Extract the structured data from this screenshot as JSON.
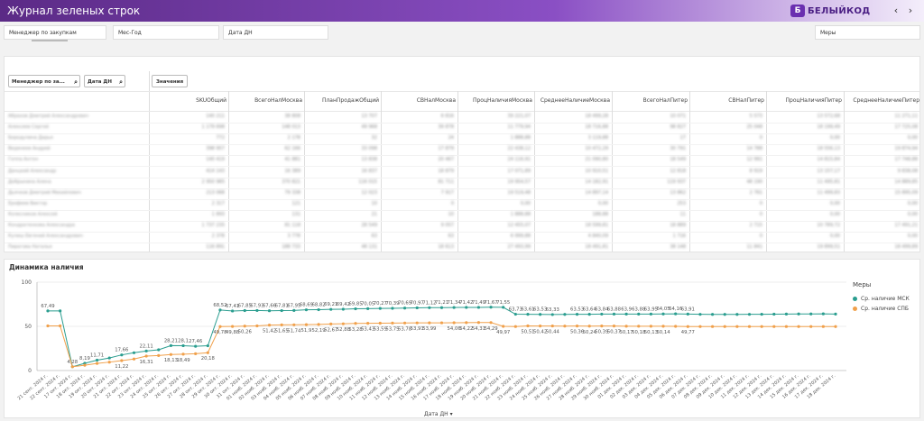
{
  "header": {
    "title": "Журнал зеленых строк",
    "logo_text": "БЕЛЫЙКОД",
    "prev_icon": "chevron-left-icon",
    "next_icon": "chevron-right-icon"
  },
  "filters": {
    "manager": "Менеджер по закупкам",
    "month_year": "Мес-Год",
    "date": "Дата ДН",
    "measures": "Меры"
  },
  "table": {
    "search_manager": "Менеджер по за...",
    "search_date": "Дата ДН",
    "values_button": "Значения",
    "columns": [
      "SKUОбщий",
      "ВсегоНалМосква",
      "ПланПродажОбщий",
      "СВНалМосква",
      "ПроцНаличияМосква",
      "СреднееНаличиеМосква",
      "ВсегоНалПитер",
      "СВНалПитер",
      "ПроцНаличияПитер",
      "СреднееНаличиеПитер"
    ],
    "rows": [
      {
        "label": "Абрахов Дмитрий Александрович",
        "cells": [
          "140 211",
          "38 808",
          "13 707",
          "6 816",
          "39 221,07",
          "18 499,28",
          "10 071",
          "5 573",
          "13 572,68",
          "11 271,11"
        ]
      },
      {
        "label": "Алексеев Сергей",
        "cells": [
          "1 179 698",
          "148 013",
          "49 968",
          "39 878",
          "11 779,94",
          "18 716,88",
          "98 827",
          "25 048",
          "18 199,49",
          "17 725,08"
        ]
      },
      {
        "label": "Бородулина Дарья",
        "cells": [
          "772",
          "2 178",
          "32",
          "24",
          "1 888,88",
          "3 119,88",
          "17",
          "0",
          "0,00",
          "0,00"
        ]
      },
      {
        "label": "Веденеев Андрей",
        "cells": [
          "398 957",
          "62 166",
          "33 098",
          "17 879",
          "22 438,12",
          "10 472,29",
          "30 791",
          "14 788",
          "18 556,13",
          "19 874,94"
        ]
      },
      {
        "label": "Гоппа Антон",
        "cells": [
          "140 419",
          "41 881",
          "13 838",
          "20 467",
          "24 116,91",
          "21 090,80",
          "18 549",
          "12 991",
          "14 815,84",
          "17 748,88"
        ]
      },
      {
        "label": "Данцкий Александр",
        "cells": [
          "414 143",
          "16 389",
          "16 837",
          "18 879",
          "17 071,89",
          "10 910,51",
          "12 818",
          "8 919",
          "13 157,17",
          "9 838,08"
        ]
      },
      {
        "label": "Добрынина Алена",
        "cells": [
          "2 950 985",
          "370 821",
          "116 015",
          "81 711",
          "19 954,57",
          "14 182,91",
          "119 937",
          "48 190",
          "11 495,81",
          "14 889,85"
        ]
      },
      {
        "label": "Дьячков Дмитрий Михайлович",
        "cells": [
          "213 068",
          "79 338",
          "12 023",
          "7 917",
          "19 519,48",
          "14 897,14",
          "13 862",
          "2 761",
          "11 499,83",
          "15 895,09"
        ]
      },
      {
        "label": "Ерофеев Виктор",
        "cells": [
          "2 317",
          "121",
          "10",
          "0",
          "0,00",
          "0,00",
          "253",
          "0",
          "0,00",
          "0,00"
        ]
      },
      {
        "label": "Колесников Алексей",
        "cells": [
          "1 893",
          "131",
          "21",
          "10",
          "1 888,88",
          "188,88",
          "11",
          "0",
          "0,00",
          "0,00"
        ]
      },
      {
        "label": "Кондратенкова Александра",
        "cells": [
          "1 737 235",
          "81 118",
          "28 549",
          "9 057",
          "12 455,07",
          "18 599,81",
          "18 889",
          "2 715",
          "10 789,72",
          "17 491,21"
        ]
      },
      {
        "label": "Кулиш Евгений Александрович",
        "cells": [
          "2 378",
          "3 778",
          "63",
          "63",
          "6 999,88",
          "4 840,09",
          "1 716",
          "0",
          "0,00",
          "0,00"
        ]
      },
      {
        "label": "Пирогова Наталья",
        "cells": [
          "116 891",
          "188 733",
          "48 131",
          "18 613",
          "27 493,99",
          "18 491,81",
          "38 148",
          "11 841",
          "19 899,51",
          "18 499,89"
        ]
      }
    ]
  },
  "chart": {
    "title": "Динамика наличия",
    "legend_title": "Меры",
    "x_title": "Дата ДН",
    "sort_icon": "caret-down-icon",
    "colors": {
      "msk": "#2a9d8f",
      "spb": "#f0a04b"
    }
  },
  "chart_data": {
    "type": "line",
    "title": "Динамика наличия",
    "xlabel": "Дата ДН",
    "ylabel": "",
    "ylim": [
      0,
      100
    ],
    "yticks": [
      0,
      50,
      100
    ],
    "x": [
      "21 сент. 2024 г.",
      "22 сент. 2024 г.",
      "17 окт. 2024 г.",
      "18 окт. 2024 г.",
      "19 окт. 2024 г.",
      "20 окт. 2024 г.",
      "21 окт. 2024 г.",
      "22 окт. 2024 г.",
      "23 окт. 2024 г.",
      "24 окт. 2024 г.",
      "25 окт. 2024 г.",
      "26 окт. 2024 г.",
      "27 окт. 2024 г.",
      "28 окт. 2024 г.",
      "29 окт. 2024 г.",
      "30 окт. 2024 г.",
      "31 окт. 2024 г.",
      "01 нояб. 2024 г.",
      "02 нояб. 2024 г.",
      "03 нояб. 2024 г.",
      "04 нояб. 2024 г.",
      "05 нояб. 2024 г.",
      "06 нояб. 2024 г.",
      "07 нояб. 2024 г.",
      "08 нояб. 2024 г.",
      "09 нояб. 2024 г.",
      "10 нояб. 2024 г.",
      "11 нояб. 2024 г.",
      "12 нояб. 2024 г.",
      "13 нояб. 2024 г.",
      "14 нояб. 2024 г.",
      "15 нояб. 2024 г.",
      "16 нояб. 2024 г.",
      "17 нояб. 2024 г.",
      "18 нояб. 2024 г.",
      "19 нояб. 2024 г.",
      "20 нояб. 2024 г.",
      "21 нояб. 2024 г.",
      "22 нояб. 2024 г.",
      "23 нояб. 2024 г.",
      "24 нояб. 2024 г.",
      "25 нояб. 2024 г.",
      "26 нояб. 2024 г.",
      "27 нояб. 2024 г.",
      "28 нояб. 2024 г.",
      "29 нояб. 2024 г.",
      "30 нояб. 2024 г.",
      "01 дек. 2024 г.",
      "02 дек. 2024 г.",
      "03 дек. 2024 г.",
      "04 дек. 2024 г.",
      "05 дек. 2024 г.",
      "06 дек. 2024 г.",
      "07 дек. 2024 г.",
      "08 дек. 2024 г.",
      "09 дек. 2024 г.",
      "10 дек. 2024 г.",
      "11 дек. 2024 г.",
      "12 дек. 2024 г.",
      "13 дек. 2024 г.",
      "14 дек. 2024 г.",
      "15 дек. 2024 г.",
      "16 дек. 2024 г.",
      "17 дек. 2024 г.",
      "18 дек. 2024 г."
    ],
    "series": [
      {
        "name": "Ср. наличие МСК",
        "values": [
          67.49,
          67.49,
          4.28,
          8.19,
          11.71,
          14.2,
          17.66,
          20.1,
          22.11,
          23.5,
          28.21,
          28.1,
          27.46,
          28.0,
          68.52,
          67.41,
          67.85,
          67.93,
          67.66,
          67.81,
          67.95,
          68.69,
          68.82,
          69.21,
          69.42,
          69.85,
          70.05,
          70.27,
          70.39,
          70.69,
          70.97,
          71.12,
          71.21,
          71.34,
          71.42,
          71.49,
          71.67,
          71.55,
          63.73,
          63.61,
          63.53,
          63.33,
          63.53,
          63.64,
          63.64,
          63.84,
          63.88,
          63.9,
          63.88,
          63.95,
          64.05,
          64.16,
          63.91,
          63.6,
          63.5,
          63.5,
          63.5,
          63.6,
          63.7,
          63.8,
          63.9,
          64.0,
          64.05,
          64.16,
          63.91
        ]
      },
      {
        "name": "Ср. наличие СПБ",
        "values": [
          50.5,
          50.5,
          4.28,
          6.0,
          8.0,
          9.5,
          11.22,
          13.0,
          16.31,
          17.0,
          18.13,
          18.49,
          19.0,
          20.18,
          49.78,
          49.88,
          50.26,
          50.5,
          51.42,
          51.65,
          51.74,
          51.9,
          52.19,
          52.67,
          52.88,
          53.28,
          53.43,
          53.59,
          53.75,
          53.78,
          53.91,
          53.99,
          54.0,
          54.06,
          54.22,
          54.31,
          54.29,
          49.97,
          49.8,
          50.51,
          50.42,
          50.44,
          50.3,
          50.36,
          50.24,
          50.39,
          50.37,
          50.17,
          50.18,
          50.13,
          50.14,
          50.0,
          49.77,
          49.8,
          49.8,
          49.8,
          49.8,
          49.8,
          49.8,
          49.8,
          49.8,
          49.8,
          49.8,
          49.8,
          49.77
        ]
      }
    ],
    "data_labels_msk": [
      "67,49",
      "",
      "4,28",
      "8,19",
      "11,71",
      "",
      "17,66",
      "",
      "22,11",
      "",
      "28,21",
      "28,1",
      "27,46",
      "",
      "68,52",
      "67,41",
      "67,85",
      "67,93",
      "67,66",
      "67,81",
      "67,95",
      "68,69",
      "68,82",
      "69,21",
      "69,42",
      "69,85",
      "70,05",
      "70,27",
      "70,39",
      "70,69",
      "70,97",
      "71,12",
      "71,21",
      "71,34",
      "71,42",
      "71,49",
      "71,67",
      "71,55",
      "63,73",
      "63,61",
      "63,53",
      "63,33",
      "",
      "63,53",
      "63,64",
      "63,84",
      "63,88",
      "63,9",
      "63,88",
      "63,95",
      "64,05",
      "64,16",
      "63,91",
      "",
      "",
      "",
      "",
      "",
      "",
      "",
      "",
      "",
      "",
      "",
      ""
    ],
    "data_labels_spb": [
      "",
      "",
      "",
      "",
      "",
      "",
      "11,22",
      "",
      "16,31",
      "",
      "18,13",
      "18,49",
      "",
      "20,18",
      "49,78",
      "49,88",
      "50,26",
      "",
      "51,42",
      "51,65",
      "51,74",
      "51,9",
      "52,19",
      "52,67",
      "52,88",
      "53,28",
      "53,43",
      "53,59",
      "53,75",
      "53,78",
      "53,91",
      "53,99",
      "",
      "54,06",
      "54,22",
      "54,31",
      "54,29",
      "49,97",
      "",
      "50,51",
      "50,42",
      "50,44",
      "",
      "50,36",
      "50,24",
      "50,39",
      "50,37",
      "50,17",
      "50,18",
      "50,13",
      "50,14",
      "",
      "49,77",
      "",
      "",
      "",
      "",
      "",
      "",
      "",
      "",
      "",
      "",
      "",
      ""
    ],
    "grid": true,
    "legend": "top-right"
  }
}
